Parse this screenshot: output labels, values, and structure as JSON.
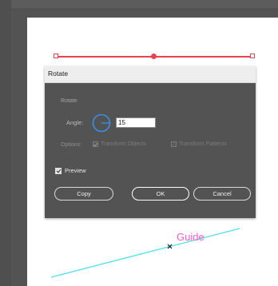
{
  "dialog": {
    "title": "Rotate",
    "section_label": "Rotate",
    "angle_label": "Angle:",
    "angle_value": "15",
    "options_label": "Options:",
    "transform_objects_label": "Transform Objects",
    "transform_objects_checked": true,
    "transform_patterns_label": "Transform Patterns",
    "transform_patterns_checked": false,
    "preview_label": "Preview",
    "preview_checked": true,
    "copy_label": "Copy",
    "ok_label": "OK",
    "cancel_label": "Cancel"
  },
  "canvas": {
    "guide_label": "Guide"
  },
  "colors": {
    "selection": "#e8424d",
    "dial": "#3a8ee6",
    "guide_line": "#49e3ec",
    "guide_text": "#f65ad2",
    "dialog_bg": "#535353"
  }
}
